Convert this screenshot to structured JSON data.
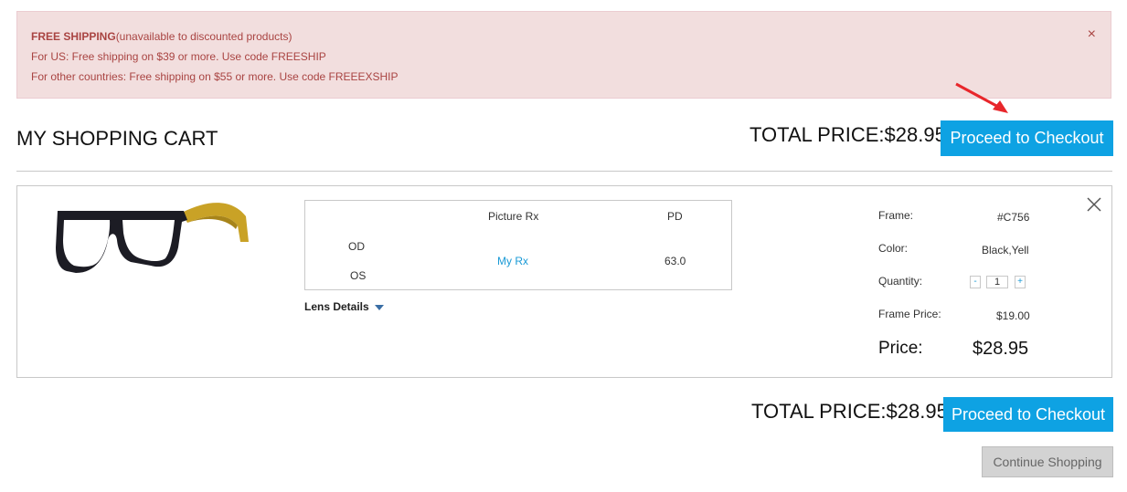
{
  "notice": {
    "title_bold": "FREE SHIPPING",
    "title_rest": "(unavailable to discounted products)",
    "line_us": "For US: Free shipping on $39 or more. Use code FREESHIP",
    "line_other": "For other countries: Free shipping on $55 or more. Use code FREEEXSHIP",
    "close_glyph": "×"
  },
  "header": {
    "title": "MY SHOPPING CART",
    "total_price": "TOTAL PRICE:$28.95",
    "checkout_label": "Proceed to Checkout"
  },
  "item": {
    "rx_table": {
      "col_picture": "Picture Rx",
      "col_pd": "PD",
      "row_od": "OD",
      "row_os": "OS",
      "rx_link": "My Rx",
      "pd_value": "63.0"
    },
    "lens_details_label": "Lens Details",
    "frame_label": "Frame:",
    "frame_value": "#C756",
    "color_label": "Color:",
    "color_value": "Black,Yell",
    "quantity_label": "Quantity:",
    "quantity_minus": "-",
    "quantity_value": "1",
    "quantity_plus": "+",
    "frame_price_label": "Frame Price:",
    "frame_price_value": "$19.00",
    "price_label": "Price:",
    "price_value": "$28.95"
  },
  "footer": {
    "total_price": "TOTAL PRICE:$28.95",
    "checkout_label": "Proceed to Checkout",
    "continue_label": "Continue Shopping"
  },
  "colors": {
    "accent_blue": "#0ea2e3",
    "notice_bg": "#f2dede",
    "notice_text": "#a94442",
    "annotation_arrow": "#e8262b"
  }
}
